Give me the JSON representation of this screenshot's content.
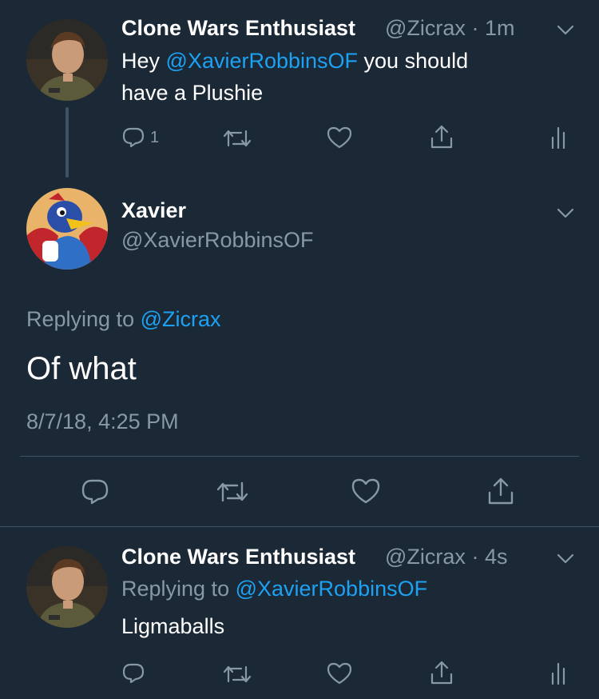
{
  "tweet1": {
    "display_name": "Clone Wars Enthusiast",
    "handle": "@Zicrax",
    "separator": "·",
    "time": "1m",
    "text_pre": "Hey ",
    "mention": "@XavierRobbinsOF",
    "text_post_line1": " you should",
    "text_line2": "have a Plushie",
    "reply_count": "1"
  },
  "focused": {
    "display_name": "Xavier",
    "handle": "@XavierRobbinsOF",
    "replying_label": "Replying to ",
    "replying_handle": "@Zicrax",
    "text": "Of what",
    "timestamp": "8/7/18, 4:25 PM"
  },
  "tweet3": {
    "display_name": "Clone Wars Enthusiast",
    "handle": "@Zicrax",
    "separator": "·",
    "time": "4s",
    "replying_label": "Replying to ",
    "replying_handle": "@XavierRobbinsOF",
    "text": "Ligmaballs"
  },
  "colors": {
    "background": "#1b2836",
    "text": "#ffffff",
    "secondary": "#8899a6",
    "accent": "#1da1f2",
    "divider": "#3d5466"
  },
  "icons": [
    "chevron-down-icon",
    "reply-icon",
    "retweet-icon",
    "like-icon",
    "share-icon",
    "analytics-icon"
  ]
}
